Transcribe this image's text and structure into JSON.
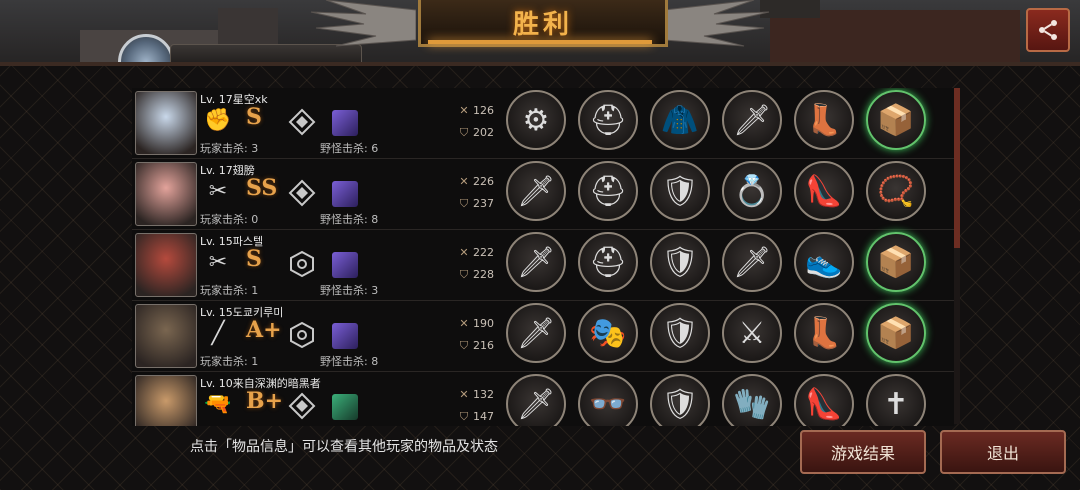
{
  "banner": {
    "title": "胜利"
  },
  "top_player": {
    "name_fragment": ""
  },
  "players": [
    {
      "level_name": "Lv. 17星空xk",
      "class_icon": "fist-icon",
      "rank": "S",
      "emblem": "diamond-emblem-icon",
      "pet": "purple-beast-icon",
      "player_kills": "玩家击杀: 3",
      "monster_kills": "野怪击杀: 6",
      "attack": "126",
      "defense": "202",
      "portrait_color": "#c9d8ea",
      "items": [
        {
          "name": "brass-knuckles-icon",
          "glyph": "⚙",
          "glow": false
        },
        {
          "name": "helmet-icon",
          "glyph": "⛑",
          "glow": false
        },
        {
          "name": "armor-icon",
          "glyph": "🧥",
          "glow": false
        },
        {
          "name": "gauntlet-icon",
          "glyph": "🗡",
          "glow": false
        },
        {
          "name": "boots-icon",
          "glyph": "👢",
          "glow": false
        },
        {
          "name": "treasure-box-icon",
          "glyph": "📦",
          "glow": true
        }
      ]
    },
    {
      "level_name": "Lv. 17翅膀",
      "class_icon": "scissors-blade-icon",
      "rank": "SS",
      "emblem": "diamond-emblem-icon",
      "pet": "purple-beast-icon",
      "player_kills": "玩家击杀: 0",
      "monster_kills": "野怪击杀: 8",
      "attack": "226",
      "defense": "237",
      "portrait_color": "#e3a39b",
      "items": [
        {
          "name": "red-sword-icon",
          "glyph": "🗡",
          "glow": false
        },
        {
          "name": "dark-helmet-icon",
          "glyph": "⛑",
          "glow": false
        },
        {
          "name": "armor-icon",
          "glyph": "🛡",
          "glow": false
        },
        {
          "name": "gold-gauntlet-icon",
          "glyph": "💍",
          "glow": false
        },
        {
          "name": "red-heels-icon",
          "glyph": "👠",
          "glow": false
        },
        {
          "name": "necklace-icon",
          "glyph": "📿",
          "glow": false
        }
      ]
    },
    {
      "level_name": "Lv. 15파스텔",
      "class_icon": "scissors-blade-icon",
      "rank": "S",
      "emblem": "hex-emblem-icon",
      "pet": "purple-beast-icon",
      "player_kills": "玩家击杀: 1",
      "monster_kills": "野怪击杀: 3",
      "attack": "222",
      "defense": "228",
      "portrait_color": "#b54a3d",
      "items": [
        {
          "name": "blue-sword-icon",
          "glyph": "🗡",
          "glow": false
        },
        {
          "name": "dark-helmet-icon",
          "glyph": "⛑",
          "glow": false
        },
        {
          "name": "purple-armor-icon",
          "glyph": "🛡",
          "glow": false
        },
        {
          "name": "gauntlet-icon",
          "glyph": "🗡",
          "glow": false
        },
        {
          "name": "tech-boots-icon",
          "glyph": "👟",
          "glow": false
        },
        {
          "name": "treasure-box-icon",
          "glyph": "📦",
          "glow": true
        }
      ]
    },
    {
      "level_name": "Lv. 15도쿄키루미",
      "class_icon": "bat-icon",
      "rank": "A+",
      "emblem": "hex-emblem-icon",
      "pet": "purple-beast-icon",
      "player_kills": "玩家击杀: 1",
      "monster_kills": "野怪击杀: 8",
      "attack": "190",
      "defense": "216",
      "portrait_color": "#7a6650",
      "items": [
        {
          "name": "red-claw-icon",
          "glyph": "🗡",
          "glow": false
        },
        {
          "name": "mask-icon",
          "glyph": "🎭",
          "glow": false
        },
        {
          "name": "armor-icon",
          "glyph": "🛡",
          "glow": false
        },
        {
          "name": "gold-blade-icon",
          "glyph": "⚔",
          "glow": false
        },
        {
          "name": "boots-icon",
          "glyph": "👢",
          "glow": false
        },
        {
          "name": "treasure-box-icon",
          "glyph": "📦",
          "glow": true
        }
      ]
    },
    {
      "level_name": "Lv. 10来自深渊的暗黑者",
      "class_icon": "pistol-icon",
      "rank": "B+",
      "emblem": "diamond-emblem-icon",
      "pet": "green-beast-icon",
      "player_kills": "",
      "monster_kills": "",
      "attack": "132",
      "defense": "147",
      "portrait_color": "#c99a6a",
      "items": [
        {
          "name": "blue-rifle-icon",
          "glyph": "🗡",
          "glow": false
        },
        {
          "name": "glasses-icon",
          "glyph": "👓",
          "glow": false
        },
        {
          "name": "white-armor-icon",
          "glyph": "🛡",
          "glow": false
        },
        {
          "name": "bracer-icon",
          "glyph": "🧤",
          "glow": false
        },
        {
          "name": "red-heels-icon",
          "glyph": "👠",
          "glow": false
        },
        {
          "name": "cross-icon",
          "glyph": "✝",
          "glow": false
        }
      ]
    }
  ],
  "footer": {
    "hint": "点击「物品信息」可以查看其他玩家的物品及状态",
    "results_button": "游戏结果",
    "exit_button": "退出"
  },
  "colors": {
    "accent_gold": "#f3b34c",
    "button_red": "#6a2a22",
    "rank_orange": "#e7a24b"
  }
}
